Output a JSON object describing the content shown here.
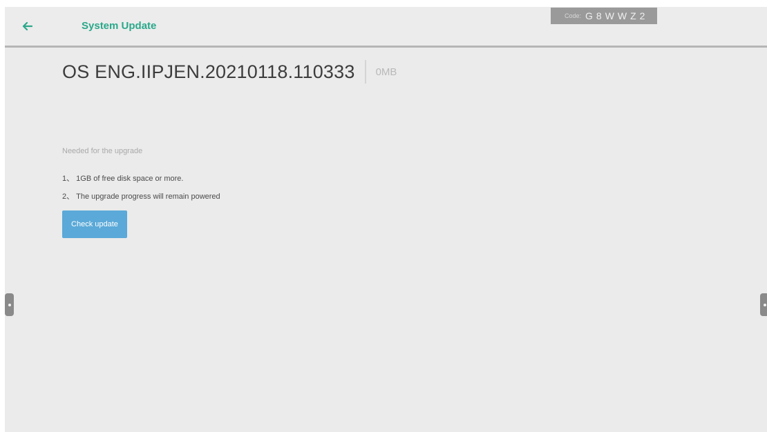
{
  "header": {
    "title": "System Update",
    "back_icon": "arrow-left-icon",
    "accent_color": "#2aa88a"
  },
  "code_badge": {
    "label": "Code:",
    "value": "G8WWZ2"
  },
  "version": {
    "name": "OS ENG.IIPJEN.20210118.110333",
    "size": "0MB"
  },
  "requirements": {
    "title": "Needed for the upgrade",
    "items": [
      "1、 1GB of free disk space or more.",
      "2、 The upgrade progress will remain powered"
    ]
  },
  "actions": {
    "check_update_label": "Check update",
    "button_color": "#5aa9d8"
  },
  "side_handles": {
    "left_icon": "handle-left-icon",
    "right_icon": "handle-right-icon"
  }
}
